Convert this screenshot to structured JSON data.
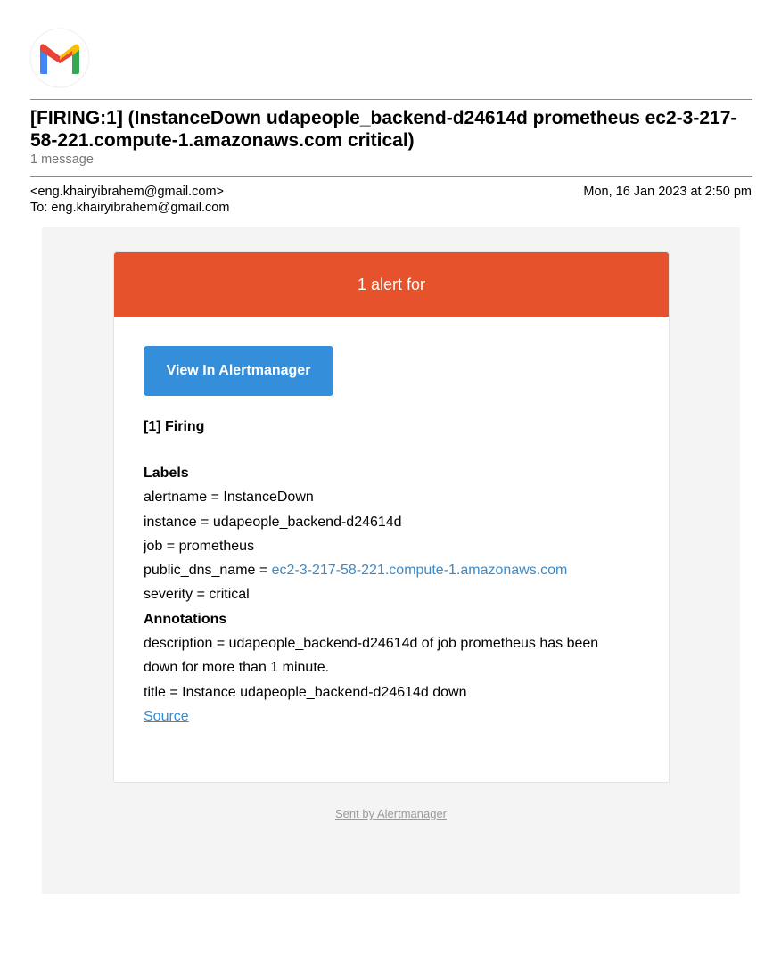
{
  "header": {
    "logo_alt": "Gmail",
    "subject": "[FIRING:1] (InstanceDown udapeople_backend-d24614d prometheus ec2-3-217-58-221.compute-1.amazonaws.com critical)",
    "message_count": "1 message"
  },
  "meta": {
    "from": "<eng.khairyibrahem@gmail.com>",
    "to": "To: eng.khairyibrahem@gmail.com",
    "date": "Mon, 16 Jan 2023 at 2:50 pm"
  },
  "alert": {
    "header_text": "1 alert for",
    "button_label": "View In Alertmanager",
    "firing_title": "[1] Firing",
    "labels_heading": "Labels",
    "labels": {
      "alertname": "alertname = InstanceDown",
      "instance": "instance = udapeople_backend-d24614d",
      "job": "job = prometheus",
      "public_dns_prefix": "public_dns_name = ",
      "public_dns_value": "ec2-3-217-58-221.compute-1.amazonaws.com",
      "severity": "severity = critical"
    },
    "annotations_heading": "Annotations",
    "annotations": {
      "description_line1": "description = udapeople_backend-d24614d of job prometheus has been",
      "description_line2": "down for more than 1 minute.",
      "title": "title = Instance udapeople_backend-d24614d down"
    },
    "source_link": "Source"
  },
  "footer": {
    "sent_by": "Sent by Alertmanager"
  },
  "colors": {
    "alert_header": "#e6522c",
    "button": "#348eda",
    "link": "#3d8ac7",
    "outer_background": "#f4f4f4"
  }
}
